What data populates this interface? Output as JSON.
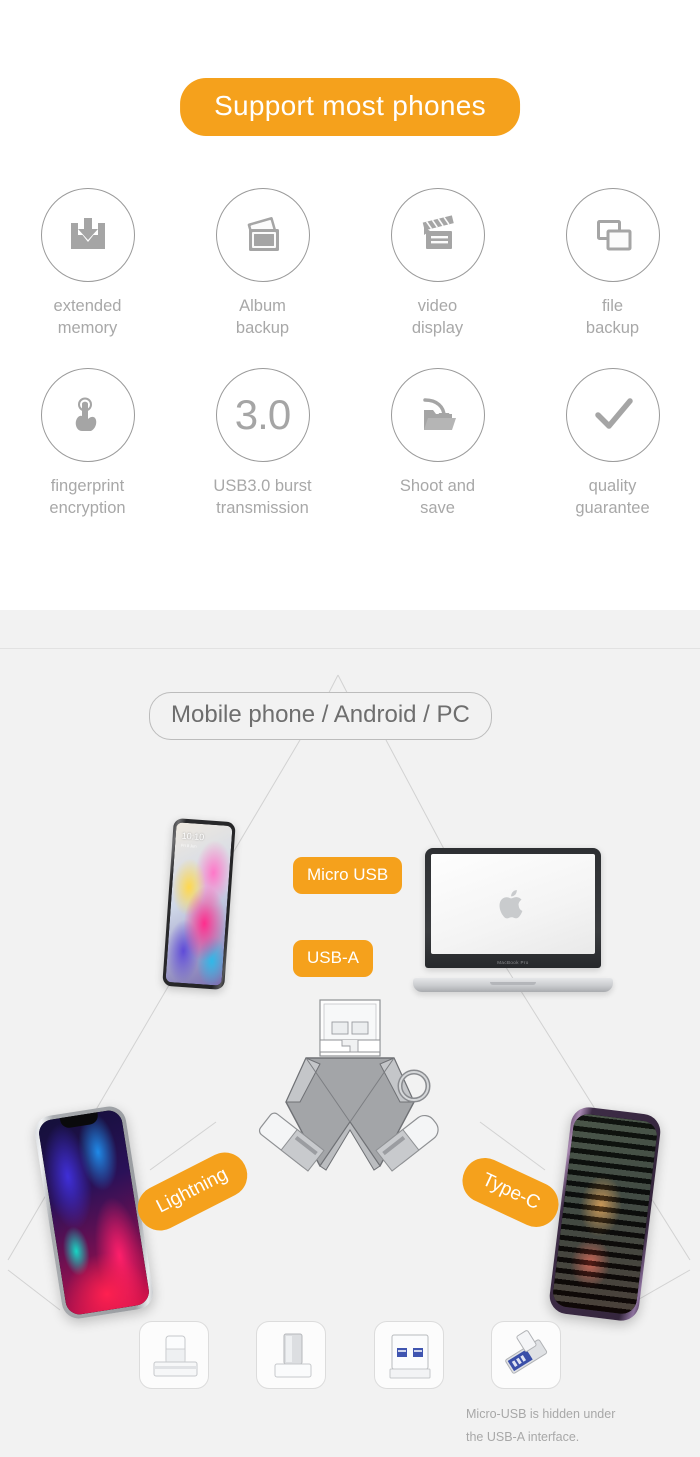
{
  "header": {
    "title": "Support most phones",
    "title_bg": "#f5a11c",
    "title_color": "#ffffff"
  },
  "features": {
    "icon_color": "#a5a5a5",
    "circle_border_color": "#9a9a9a",
    "label_color": "#a8a8a8",
    "rows": [
      [
        {
          "icon": "download-tray-icon",
          "label": "extended\nmemory",
          "line1": "extended",
          "line2": "memory"
        },
        {
          "icon": "photo-stack-icon",
          "label": "Album\nbackup",
          "line1": "Album",
          "line2": "backup"
        },
        {
          "icon": "clapperboard-icon",
          "label": "video\ndisplay",
          "line1": "video",
          "line2": "display"
        },
        {
          "icon": "copy-files-icon",
          "label": "file\nbackup",
          "line1": "file",
          "line2": "backup"
        }
      ],
      [
        {
          "icon": "fingerprint-touch-icon",
          "label": "fingerprint\nencryption",
          "line1": "fingerprint",
          "line2": "encryption"
        },
        {
          "icon": "usb-version-text-icon",
          "label": "USB3.0 burst\ntransmission",
          "line1": "USB3.0 burst",
          "line2": "transmission",
          "text": "3.0"
        },
        {
          "icon": "folder-import-icon",
          "label": "Shoot and\nsave",
          "line1": "Shoot and",
          "line2": "save"
        },
        {
          "icon": "checkmark-icon",
          "label": "quality\nguarantee",
          "line1": "quality",
          "line2": "guarantee"
        }
      ]
    ]
  },
  "compatibility": {
    "background": "#f2f2f2",
    "pill_label": "Mobile phone / Android / PC",
    "pill_text_color": "#6e6e6e",
    "badge_color": "#f5a11c",
    "badges": [
      {
        "name": "micro-usb",
        "label": "Micro USB"
      },
      {
        "name": "usb-a",
        "label": "USB-A"
      },
      {
        "name": "lightning",
        "label": "Lightning"
      },
      {
        "name": "type-c",
        "label": "Type-C"
      }
    ],
    "devices": [
      {
        "name": "android-phone",
        "screen_time": "10:10",
        "screen_date": "Fri 8 Jun"
      },
      {
        "name": "macbook-laptop",
        "brand_label": "MacBook Pro"
      },
      {
        "name": "iphone-x",
        "screen_time": ""
      },
      {
        "name": "galaxy-phone",
        "screen_time": ""
      }
    ],
    "thumbnails": [
      {
        "name": "thumb-lightning-connector"
      },
      {
        "name": "thumb-type-c-connector"
      },
      {
        "name": "thumb-usb-a-connector"
      },
      {
        "name": "thumb-micro-usb-connector"
      }
    ],
    "footnote_line1": "Micro-USB is hidden under",
    "footnote_line2": "the USB-A interface."
  }
}
